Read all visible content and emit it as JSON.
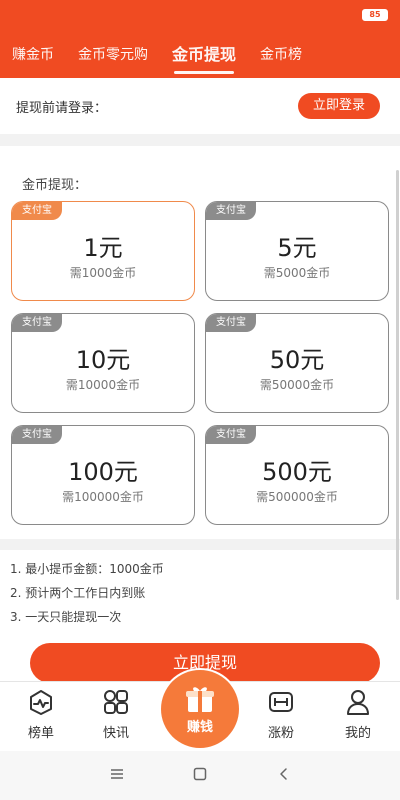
{
  "status": {
    "battery": "85"
  },
  "tabs": [
    {
      "label": "赚金币"
    },
    {
      "label": "金币零元购"
    },
    {
      "label": "金币提现"
    },
    {
      "label": "金币榜"
    }
  ],
  "login": {
    "prompt": "提现前请登录：",
    "button": "立即登录"
  },
  "withdraw": {
    "title": "金币提现：",
    "options": [
      {
        "badge": "支付宝",
        "amount": "1元",
        "cost": "需1000金币"
      },
      {
        "badge": "支付宝",
        "amount": "5元",
        "cost": "需5000金币"
      },
      {
        "badge": "支付宝",
        "amount": "10元",
        "cost": "需10000金币"
      },
      {
        "badge": "支付宝",
        "amount": "50元",
        "cost": "需50000金币"
      },
      {
        "badge": "支付宝",
        "amount": "100元",
        "cost": "需100000金币"
      },
      {
        "badge": "支付宝",
        "amount": "500元",
        "cost": "需500000金币"
      }
    ]
  },
  "rules": [
    "1. 最小提币金额：1000金币",
    "2. 预计两个工作日内到账",
    "3. 一天只能提现一次"
  ],
  "action": {
    "withdraw_button": "立即提现"
  },
  "bottom_nav": [
    {
      "label": "榜单",
      "icon": "chart-icon"
    },
    {
      "label": "快讯",
      "icon": "apps-icon"
    },
    {
      "label": "赚钱",
      "icon": "gift-icon"
    },
    {
      "label": "涨粉",
      "icon": "dumbbell-icon"
    },
    {
      "label": "我的",
      "icon": "user-icon"
    }
  ],
  "colors": {
    "accent": "#f04b22",
    "selected_border": "#f08a4b",
    "earn_button": "#f57a3a"
  }
}
